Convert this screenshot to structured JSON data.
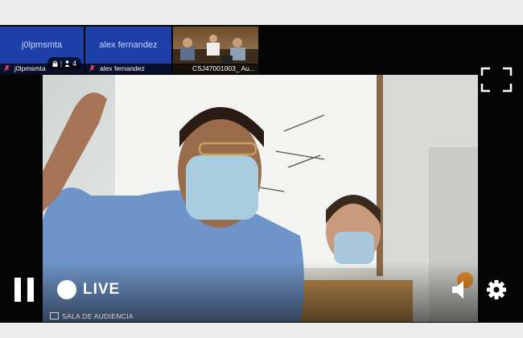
{
  "participants": [
    {
      "tile_name": "j0lpmsmta",
      "label": "j0lpmsmta",
      "type": "name"
    },
    {
      "tile_name": "alex fernandez",
      "label": "alex fernandez",
      "type": "name"
    },
    {
      "label": "CSJ47001003_ Au...",
      "type": "camera"
    }
  ],
  "viewer_badge": {
    "count": "4"
  },
  "controls": {
    "live_label": "LIVE"
  },
  "room_caption": "SALA DE AUDIENCIA",
  "icons": {
    "lock": "lock-icon",
    "person": "person-icon",
    "muted_mic": "muted-mic-icon",
    "fullscreen": "fullscreen-icon",
    "pause": "pause-icon",
    "volume": "volume-icon",
    "settings": "gear-icon"
  },
  "colors": {
    "tile_blue": "#1f3fa8",
    "mic_muted": "#e0406a",
    "player_bg": "#050505"
  }
}
